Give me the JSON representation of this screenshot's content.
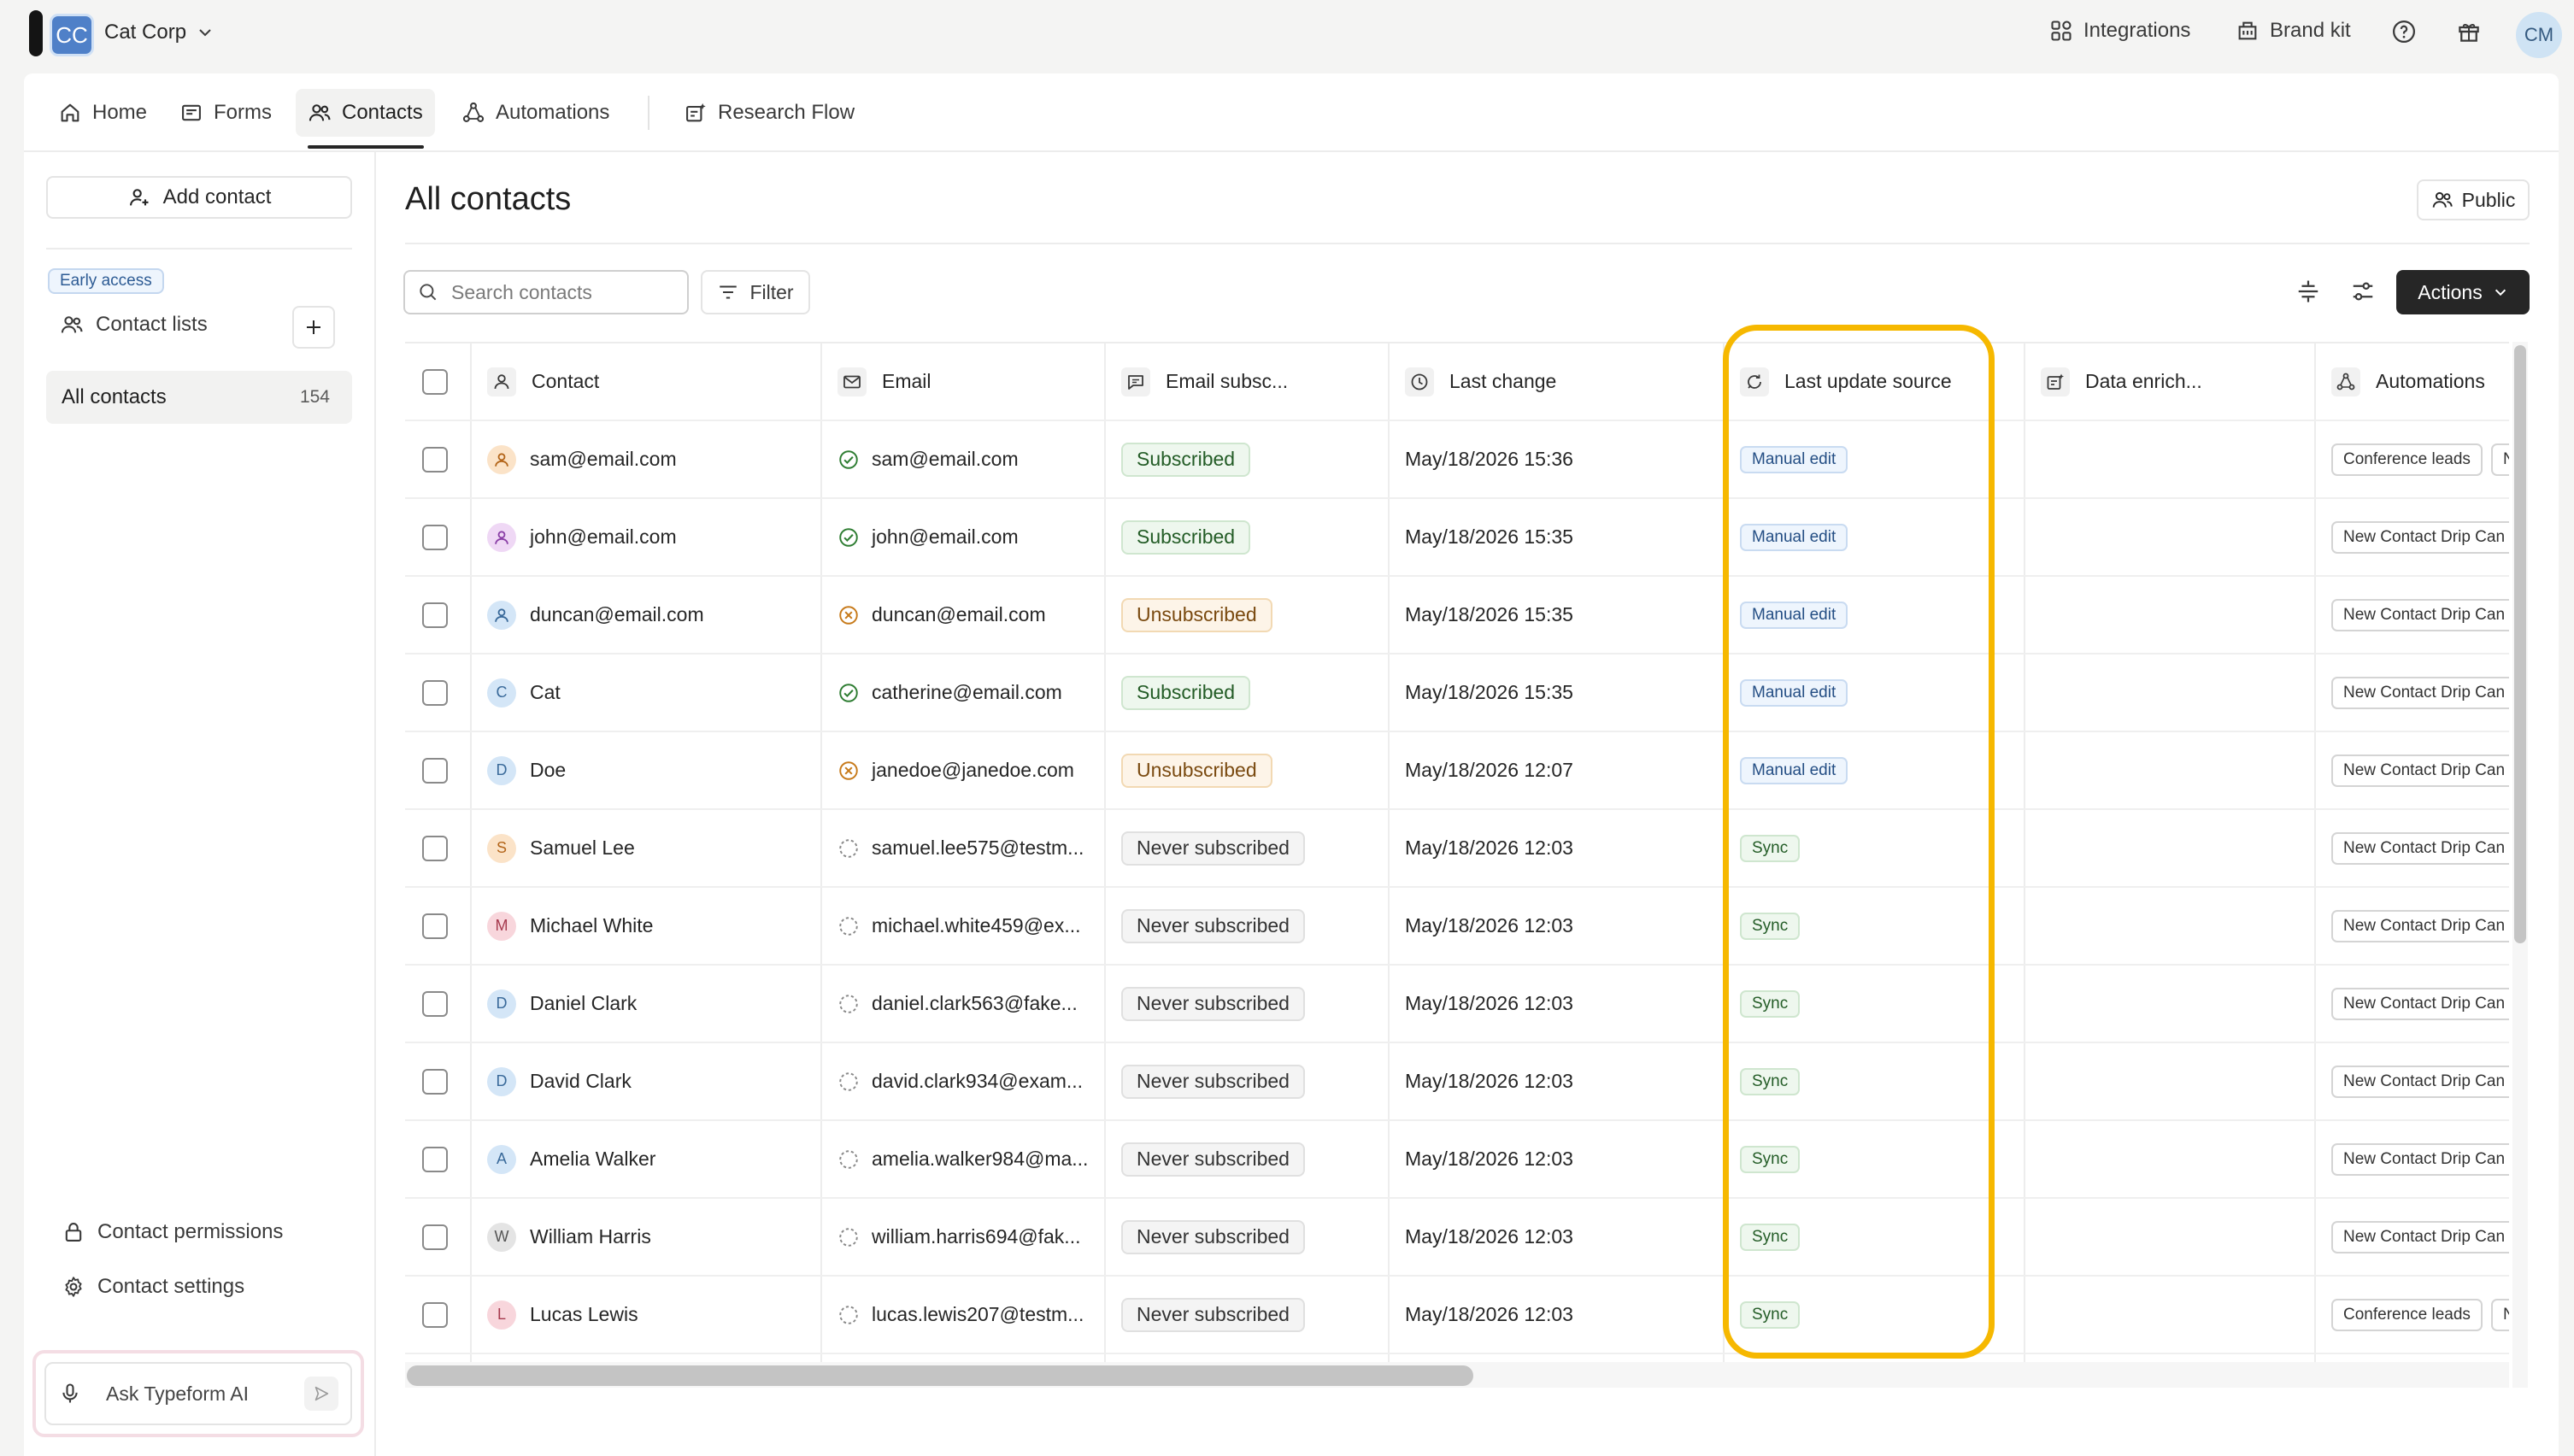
{
  "workspace": {
    "initials": "CC",
    "name": "Cat Corp"
  },
  "topbar": {
    "integrations": "Integrations",
    "brand_kit": "Brand kit",
    "user_initials": "CM"
  },
  "nav": {
    "home": "Home",
    "forms": "Forms",
    "contacts": "Contacts",
    "automations": "Automations",
    "research_flow": "Research Flow"
  },
  "sidebar": {
    "add_contact": "Add contact",
    "early_access": "Early access",
    "contact_lists": "Contact lists",
    "all_contacts": "All contacts",
    "all_contacts_count": "154",
    "contact_permissions": "Contact permissions",
    "contact_settings": "Contact settings",
    "ai_prompt": "Ask Typeform AI"
  },
  "main": {
    "title": "All contacts",
    "visibility": "Public",
    "search_placeholder": "Search contacts",
    "filter": "Filter",
    "actions": "Actions"
  },
  "table": {
    "columns": {
      "contact": "Contact",
      "email": "Email",
      "email_subscription": "Email subsc...",
      "last_change": "Last change",
      "last_update_source": "Last update source",
      "data_enrichment": "Data enrich...",
      "automations": "Automations"
    },
    "rows": [
      {
        "contact": "sam@email.com",
        "avatar": "person-icon",
        "avatar_bg": "#fbe3c8",
        "avatar_fg": "#b3651a",
        "email": "sam@email.com",
        "email_status": "valid",
        "subscription": "Subscribed",
        "sub_type": "sub",
        "last_change": "May/18/2026 15:36",
        "source": "Manual edit",
        "source_type": "manual",
        "automations": [
          "Conference leads",
          "N"
        ]
      },
      {
        "contact": "john@email.com",
        "avatar": "person-icon",
        "avatar_bg": "#efd8f5",
        "avatar_fg": "#8a3fa6",
        "email": "john@email.com",
        "email_status": "valid",
        "subscription": "Subscribed",
        "sub_type": "sub",
        "last_change": "May/18/2026 15:35",
        "source": "Manual edit",
        "source_type": "manual",
        "automations": [
          "New Contact Drip Can"
        ]
      },
      {
        "contact": "duncan@email.com",
        "avatar": "person-icon",
        "avatar_bg": "#d4e6f7",
        "avatar_fg": "#3a6a9a",
        "email": "duncan@email.com",
        "email_status": "invalid",
        "subscription": "Unsubscribed",
        "sub_type": "unsub",
        "last_change": "May/18/2026 15:35",
        "source": "Manual edit",
        "source_type": "manual",
        "automations": [
          "New Contact Drip Can"
        ]
      },
      {
        "contact": "Cat",
        "avatar": "C",
        "avatar_bg": "#d4e6f7",
        "avatar_fg": "#3a6a9a",
        "email": "catherine@email.com",
        "email_status": "valid",
        "subscription": "Subscribed",
        "sub_type": "sub",
        "last_change": "May/18/2026 15:35",
        "source": "Manual edit",
        "source_type": "manual",
        "automations": [
          "New Contact Drip Can"
        ]
      },
      {
        "contact": "Doe",
        "avatar": "D",
        "avatar_bg": "#d4e6f7",
        "avatar_fg": "#3a6a9a",
        "email": "janedoe@janedoe.com",
        "email_status": "invalid",
        "subscription": "Unsubscribed",
        "sub_type": "unsub",
        "last_change": "May/18/2026 12:07",
        "source": "Manual edit",
        "source_type": "manual",
        "automations": [
          "New Contact Drip Can"
        ]
      },
      {
        "contact": "Samuel Lee",
        "avatar": "S",
        "avatar_bg": "#fbe3c8",
        "avatar_fg": "#b3651a",
        "email": "samuel.lee575@testm...",
        "email_status": "unknown",
        "subscription": "Never subscribed",
        "sub_type": "never",
        "last_change": "May/18/2026 12:03",
        "source": "Sync",
        "source_type": "sync",
        "automations": [
          "New Contact Drip Can"
        ]
      },
      {
        "contact": "Michael White",
        "avatar": "M",
        "avatar_bg": "#f8d6dc",
        "avatar_fg": "#a63a4e",
        "email": "michael.white459@ex...",
        "email_status": "unknown",
        "subscription": "Never subscribed",
        "sub_type": "never",
        "last_change": "May/18/2026 12:03",
        "source": "Sync",
        "source_type": "sync",
        "automations": [
          "New Contact Drip Can"
        ]
      },
      {
        "contact": "Daniel Clark",
        "avatar": "D",
        "avatar_bg": "#d4e6f7",
        "avatar_fg": "#3a6a9a",
        "email": "daniel.clark563@fake...",
        "email_status": "unknown",
        "subscription": "Never subscribed",
        "sub_type": "never",
        "last_change": "May/18/2026 12:03",
        "source": "Sync",
        "source_type": "sync",
        "automations": [
          "New Contact Drip Can"
        ]
      },
      {
        "contact": "David Clark",
        "avatar": "D",
        "avatar_bg": "#d4e6f7",
        "avatar_fg": "#3a6a9a",
        "email": "david.clark934@exam...",
        "email_status": "unknown",
        "subscription": "Never subscribed",
        "sub_type": "never",
        "last_change": "May/18/2026 12:03",
        "source": "Sync",
        "source_type": "sync",
        "automations": [
          "New Contact Drip Can"
        ]
      },
      {
        "contact": "Amelia Walker",
        "avatar": "A",
        "avatar_bg": "#d4e6f7",
        "avatar_fg": "#3a6a9a",
        "email": "amelia.walker984@ma...",
        "email_status": "unknown",
        "subscription": "Never subscribed",
        "sub_type": "never",
        "last_change": "May/18/2026 12:03",
        "source": "Sync",
        "source_type": "sync",
        "automations": [
          "New Contact Drip Can"
        ]
      },
      {
        "contact": "William Harris",
        "avatar": "W",
        "avatar_bg": "#e4e4e4",
        "avatar_fg": "#555555",
        "email": "william.harris694@fak...",
        "email_status": "unknown",
        "subscription": "Never subscribed",
        "sub_type": "never",
        "last_change": "May/18/2026 12:03",
        "source": "Sync",
        "source_type": "sync",
        "automations": [
          "New Contact Drip Can"
        ]
      },
      {
        "contact": "Lucas Lewis",
        "avatar": "L",
        "avatar_bg": "#f8d6dc",
        "avatar_fg": "#a63a4e",
        "email": "lucas.lewis207@testm...",
        "email_status": "unknown",
        "subscription": "Never subscribed",
        "sub_type": "never",
        "last_change": "May/18/2026 12:03",
        "source": "Sync",
        "source_type": "sync",
        "automations": [
          "Conference leads",
          "N"
        ]
      }
    ]
  },
  "colors": {
    "highlight": "#f6b800",
    "primary_button": "#262626",
    "valid": "#2e7d32",
    "invalid": "#c77a1a"
  }
}
